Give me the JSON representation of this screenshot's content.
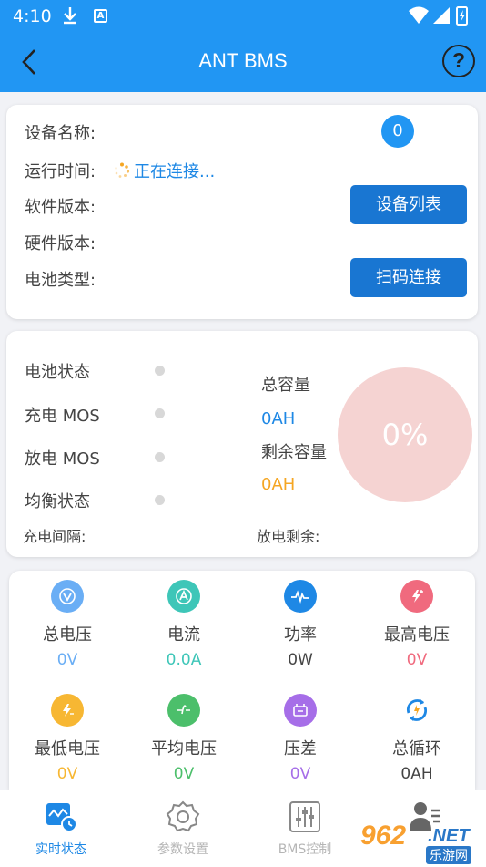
{
  "status_bar": {
    "time": "4:10"
  },
  "app_bar": {
    "title": "ANT BMS",
    "help": "?"
  },
  "device": {
    "name_label": "设备名称:",
    "badge_count": "0",
    "runtime_label": "运行时间:",
    "connecting_text": "正在连接...",
    "software_label": "软件版本:",
    "hardware_label": "硬件版本:",
    "battery_type_label": "电池类型:",
    "device_list_button": "设备列表",
    "scan_connect_button": "扫码连接"
  },
  "battery_status": {
    "battery_state_label": "电池状态",
    "charge_mos_label": "充电 MOS",
    "discharge_mos_label": "放电 MOS",
    "balance_label": "均衡状态",
    "total_capacity_label": "总容量",
    "total_capacity_value": "0AH",
    "remaining_capacity_label": "剩余容量",
    "remaining_capacity_value": "0AH",
    "charge_interval_label": "充电间隔:",
    "discharge_remaining_label": "放电剩余:",
    "soc_percent": "0%"
  },
  "metrics": [
    {
      "name": "总电压",
      "value": "0V",
      "icon": "voltage-icon",
      "color": "#6aaef5",
      "value_color": "#6aaef5"
    },
    {
      "name": "电流",
      "value": "0.0A",
      "icon": "current-icon",
      "color": "#3ec6b8",
      "value_color": "#3ec6b8"
    },
    {
      "name": "功率",
      "value": "0W",
      "icon": "power-icon",
      "color": "#1e88e5",
      "value_color": "#444444"
    },
    {
      "name": "最高电压",
      "value": "0V",
      "icon": "max-voltage-icon",
      "color": "#f06a7e",
      "value_color": "#f06a7e"
    },
    {
      "name": "最低电压",
      "value": "0V",
      "icon": "min-voltage-icon",
      "color": "#f7b733",
      "value_color": "#f7b733"
    },
    {
      "name": "平均电压",
      "value": "0V",
      "icon": "avg-voltage-icon",
      "color": "#4cbf6b",
      "value_color": "#4cbf6b"
    },
    {
      "name": "压差",
      "value": "0V",
      "icon": "voltage-diff-icon",
      "color": "#a66ee8",
      "value_color": "#a66ee8"
    },
    {
      "name": "总循环",
      "value": "0AH",
      "icon": "cycle-icon",
      "color": "#1e88e5",
      "value_color": "#444444"
    }
  ],
  "bottom_nav": [
    {
      "label": "实时状态",
      "icon": "realtime-icon",
      "active": true
    },
    {
      "label": "参数设置",
      "icon": "settings-gear-icon",
      "active": false
    },
    {
      "label": "BMS控制",
      "icon": "sliders-icon",
      "active": false
    },
    {
      "label": "",
      "icon": "user-icon",
      "active": false
    }
  ],
  "watermark": {
    "brand": "962",
    "suffix": ".NET",
    "site": "乐游网"
  }
}
